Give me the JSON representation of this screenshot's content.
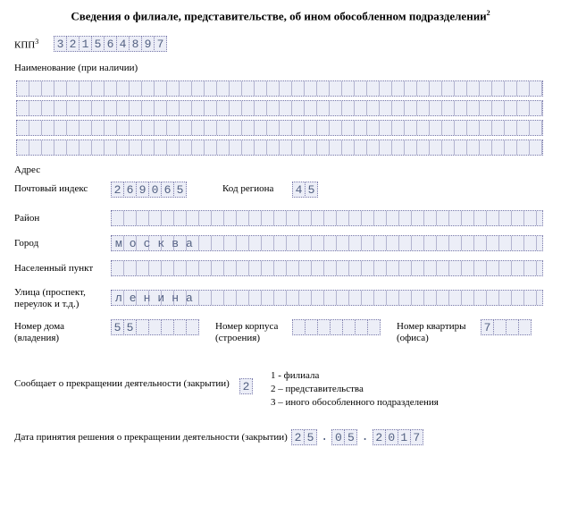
{
  "title": "Сведения о филиале, представительстве, об ином обособленном подразделении",
  "title_note": "2",
  "kpp": {
    "label": "КПП",
    "note": "3",
    "value": "321564897"
  },
  "name_section": {
    "label": "Наименование (при наличии)",
    "lines": [
      "",
      "",
      "",
      ""
    ]
  },
  "address_heading": "Адрес",
  "postal": {
    "label": "Почтовый индекс",
    "value": "269065"
  },
  "region": {
    "label": "Код региона",
    "value": "45"
  },
  "district": {
    "label": "Район",
    "value": ""
  },
  "city": {
    "label": "Город",
    "value": "москва"
  },
  "settlement": {
    "label": "Населенный пункт",
    "value": ""
  },
  "street": {
    "label": "Улица (проспект, переулок и т.д.)",
    "value": "ленина"
  },
  "house": {
    "label": "Номер дома (владения)",
    "value": "55"
  },
  "building": {
    "label": "Номер корпуса (строения)",
    "value": ""
  },
  "apartment": {
    "label": "Номер квартиры (офиса)",
    "value": "7"
  },
  "closure_notice": {
    "label": "Сообщает о прекращении деятельности (закрытии)",
    "value": "2",
    "legend": [
      "1 - филиала",
      "2 – представительства",
      "3 – иного обособленного подразделения"
    ]
  },
  "closure_date": {
    "label": "Дата принятия решения о прекращении деятельности (закрытии)",
    "day": "25",
    "month": "05",
    "year": "2017"
  }
}
